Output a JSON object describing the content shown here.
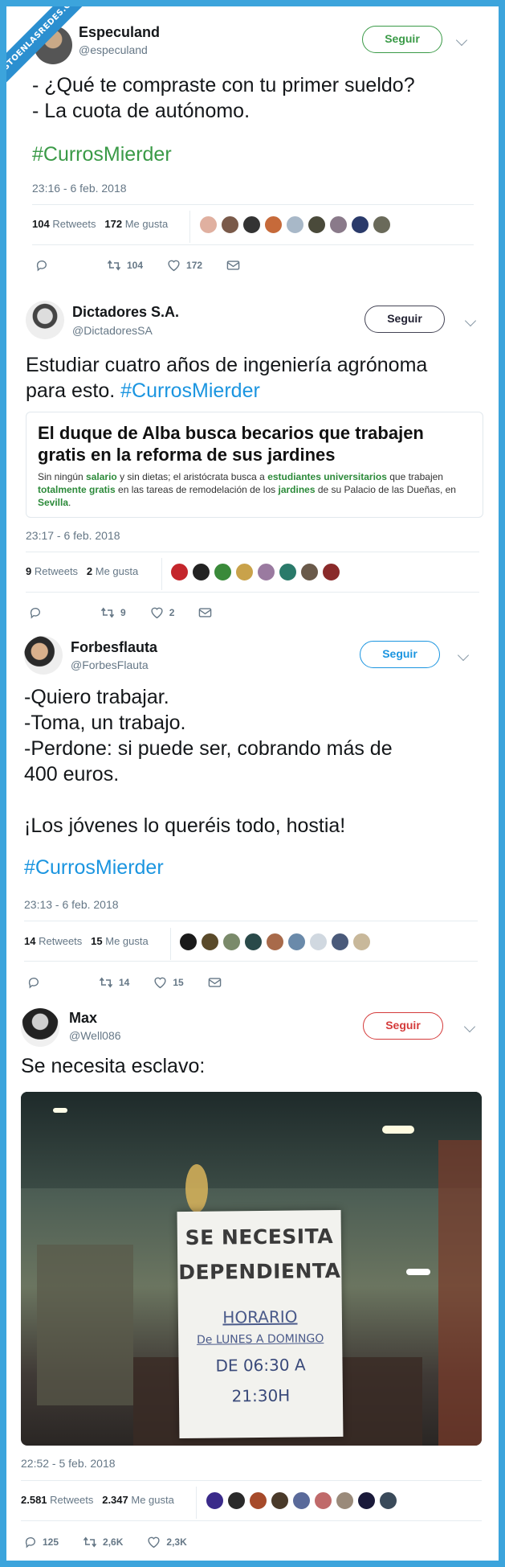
{
  "watermark": "VISTOENLASREDES.COM",
  "tweets": [
    {
      "name": "Especuland",
      "handle": "@especuland",
      "follow": "Seguir",
      "lines": [
        "- ¿Qué te compraste con tu primer sueldo?",
        "- La cuota de autónomo."
      ],
      "hashtag": "#CurrosMierder",
      "time": "23:16 - 6 feb. 2018",
      "retweets_n": "104",
      "retweets_l": "Retweets",
      "likes_n": "172",
      "likes_l": "Me gusta",
      "reply_count": "",
      "rt_count": "104",
      "like_count": "172"
    },
    {
      "name": "Dictadores S.A.",
      "handle": "@DictadoresSA",
      "follow": "Seguir",
      "lines": [
        "Estudiar cuatro años de ingeniería agrónoma",
        "para esto. "
      ],
      "hashtag": "#CurrosMierder",
      "card_title": "El duque de Alba busca becarios que trabajen gratis en la reforma de sus jardines",
      "card_body": {
        "p1": "Sin ningún ",
        "k1": "salario",
        "p2": " y sin dietas; el aristócrata busca a ",
        "k2": "estudiantes universitarios",
        "p3": " que trabajen ",
        "k3": "totalmente gratis",
        "p4": " en las tareas de remodelación de los ",
        "k4": "jardines",
        "p5": " de su Palacio de las Dueñas, en ",
        "k5": "Sevilla",
        "p6": "."
      },
      "time": "23:17 - 6 feb. 2018",
      "retweets_n": "9",
      "retweets_l": "Retweets",
      "likes_n": "2",
      "likes_l": "Me gusta",
      "rt_count": "9",
      "like_count": "2"
    },
    {
      "name": "Forbesflauta",
      "handle": "@ForbesFlauta",
      "follow": "Seguir",
      "lines": [
        "-Quiero trabajar.",
        "-Toma, un trabajo.",
        "-Perdone: si puede ser, cobrando más de",
        "400 euros.",
        "",
        "¡Los jóvenes lo queréis todo, hostia!"
      ],
      "hashtag": "#CurrosMierder",
      "time": "23:13 - 6 feb. 2018",
      "retweets_n": "14",
      "retweets_l": "Retweets",
      "likes_n": "15",
      "likes_l": "Me gusta",
      "rt_count": "14",
      "like_count": "15"
    },
    {
      "name": "Max",
      "handle": "@Well086",
      "follow": "Seguir",
      "lines": [
        "Se necesita esclavo:"
      ],
      "sign": [
        "SE NECESITA",
        "DEPENDIENTA",
        "HORARIO",
        "De LUNES A DOMINGO",
        "DE 06:30 A",
        "21:30H"
      ],
      "time": "22:52 - 5 feb. 2018",
      "retweets_n": "2.581",
      "retweets_l": "Retweets",
      "likes_n": "2.347",
      "likes_l": "Me gusta",
      "reply_count": "125",
      "rt_count": "2,6K",
      "like_count": "2,3K"
    }
  ],
  "colors": {
    "accent": "#1b95e0",
    "follow_green": "#3a9a47",
    "follow_red": "#d43a3a",
    "border": "#3ca4dc"
  },
  "icons": [
    "reply-icon",
    "retweet-icon",
    "like-icon",
    "message-icon",
    "chevron-down-icon"
  ]
}
